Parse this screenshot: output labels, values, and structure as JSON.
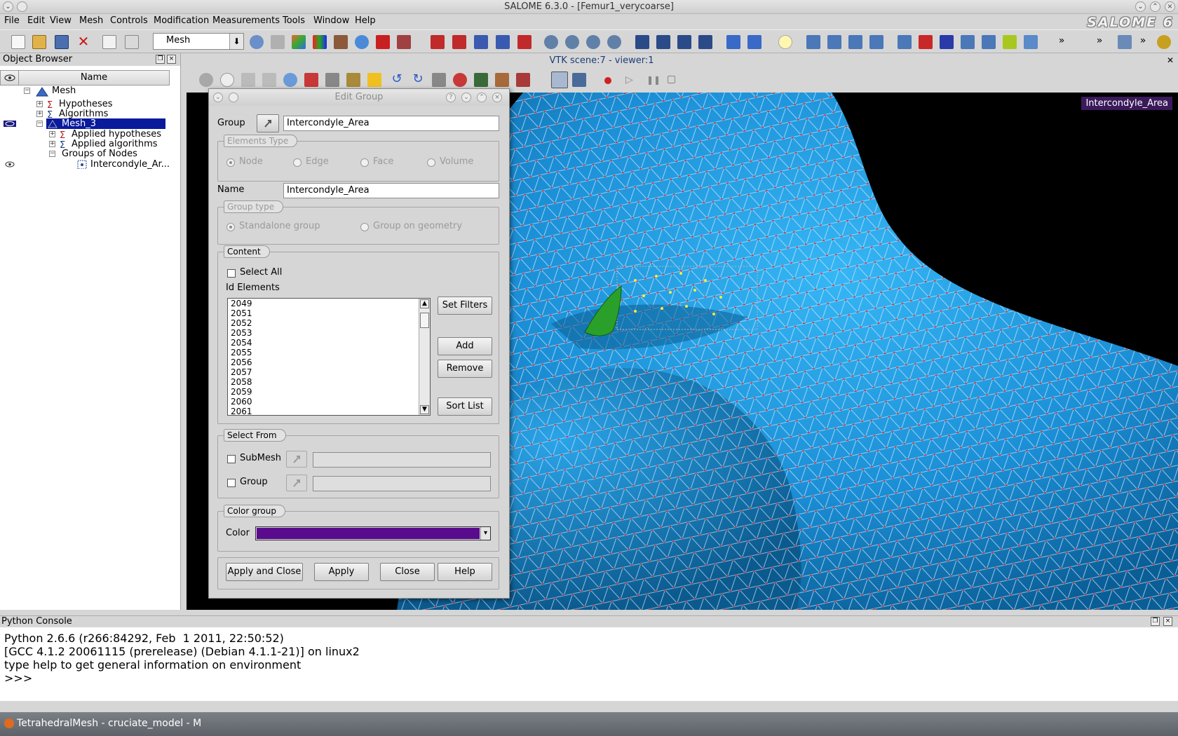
{
  "window": {
    "title": "SALOME 6.3.0 - [Femur1_verycoarse]",
    "logo": "SALOME 6"
  },
  "menubar": [
    "File",
    "Edit",
    "View",
    "Mesh",
    "Controls",
    "Modification",
    "Measurements",
    "Tools",
    "Window",
    "Help"
  ],
  "toolbar": {
    "module_value": "Mesh"
  },
  "object_browser": {
    "title": "Object Browser",
    "column_name": "Name",
    "tree": {
      "root": "Mesh",
      "hypotheses": "Hypotheses",
      "algorithms": "Algorithms",
      "mesh3": "Mesh_3",
      "applied_hypotheses": "Applied hypotheses",
      "applied_algorithms": "Applied algorithms",
      "groups_of_nodes": "Groups of Nodes",
      "group_item": "Intercondyle_Ar..."
    }
  },
  "viewer": {
    "title": "VTK scene:7 - viewer:1",
    "overlay_label": "Intercondyle_Area",
    "colors": {
      "mesh_surface": "#1e9be0",
      "mesh_node": "#e02020",
      "selected_node": "#f4ee40",
      "background": "#000000"
    }
  },
  "dialog": {
    "title": "Edit Group",
    "group_label": "Group",
    "group_value": "Intercondyle_Area",
    "elements_type_title": "Elements Type",
    "elements_types": [
      "Node",
      "Edge",
      "Face",
      "Volume"
    ],
    "elements_type_selected": "Node",
    "name_label": "Name",
    "name_value": "Intercondyle_Area",
    "group_type_title": "Group type",
    "group_types": [
      "Standalone group",
      "Group on geometry"
    ],
    "group_type_selected": "Standalone group",
    "content_title": "Content",
    "select_all_label": "Select All",
    "id_elements_label": "Id Elements",
    "id_elements": [
      "2049",
      "2051",
      "2052",
      "2053",
      "2054",
      "2055",
      "2056",
      "2057",
      "2058",
      "2059",
      "2060",
      "2061"
    ],
    "set_filters_label": "Set Filters",
    "add_label": "Add",
    "remove_label": "Remove",
    "sort_list_label": "Sort List",
    "select_from_title": "Select From",
    "submesh_label": "SubMesh",
    "submesh_value": "",
    "group_check_label": "Group",
    "group_check_value": "",
    "color_group_title": "Color group",
    "color_label": "Color",
    "color_value": "#5a0a8c",
    "apply_and_close_label": "Apply and Close",
    "apply_label": "Apply",
    "close_label": "Close",
    "help_label": "Help"
  },
  "console": {
    "title": "Python Console",
    "lines": [
      "Python 2.6.6 (r266:84292, Feb  1 2011, 22:50:52)",
      "[GCC 4.1.2 20061115 (prerelease) (Debian 4.1.1-21)] on linux2",
      "type help to get general information on environment",
      ">>>"
    ]
  },
  "taskbar": {
    "task_label": "TetrahedralMesh - cruciate_model - M"
  }
}
